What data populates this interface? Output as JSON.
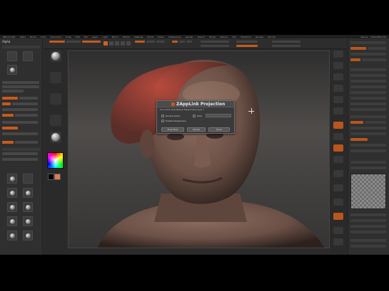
{
  "menubar": {
    "items": [
      "ZBrush 4R2",
      "Alpha",
      "Brush",
      "Color",
      "Document",
      "Draw",
      "Edit",
      "File",
      "Layer",
      "Light",
      "Macro",
      "Marker",
      "Material",
      "Movie",
      "Picker",
      "Preferences",
      "Render",
      "Stencil",
      "Stroke",
      "Texture",
      "Tool",
      "Transform",
      "Zplugin",
      "Zscript"
    ],
    "right_items": [
      "Menus",
      "DefaultZScript"
    ]
  },
  "left_tray": {
    "title": "Alpha"
  },
  "dialog": {
    "title": "ZAppLink Projection",
    "description": "Drop Action  Fade  Restore  Merge  Enable Layer 1",
    "options": [
      {
        "label": "Double Sided"
      },
      {
        "label": "Enable Perspective"
      }
    ],
    "fade_label": "Fade",
    "buttons": [
      "Drop Now",
      "Cancel",
      "Done"
    ]
  },
  "colors": {
    "accent": "#c65a1e",
    "panel": "#2f2f2f",
    "canvas_top": "#2f2e2e",
    "canvas_mid": "#4f4c4a",
    "skin": "#7a5d52"
  },
  "icons": {
    "crosshair": "crosshair-cursor-icon",
    "material": "material-sphere-icon",
    "color_picker": "color-picker-icon"
  }
}
